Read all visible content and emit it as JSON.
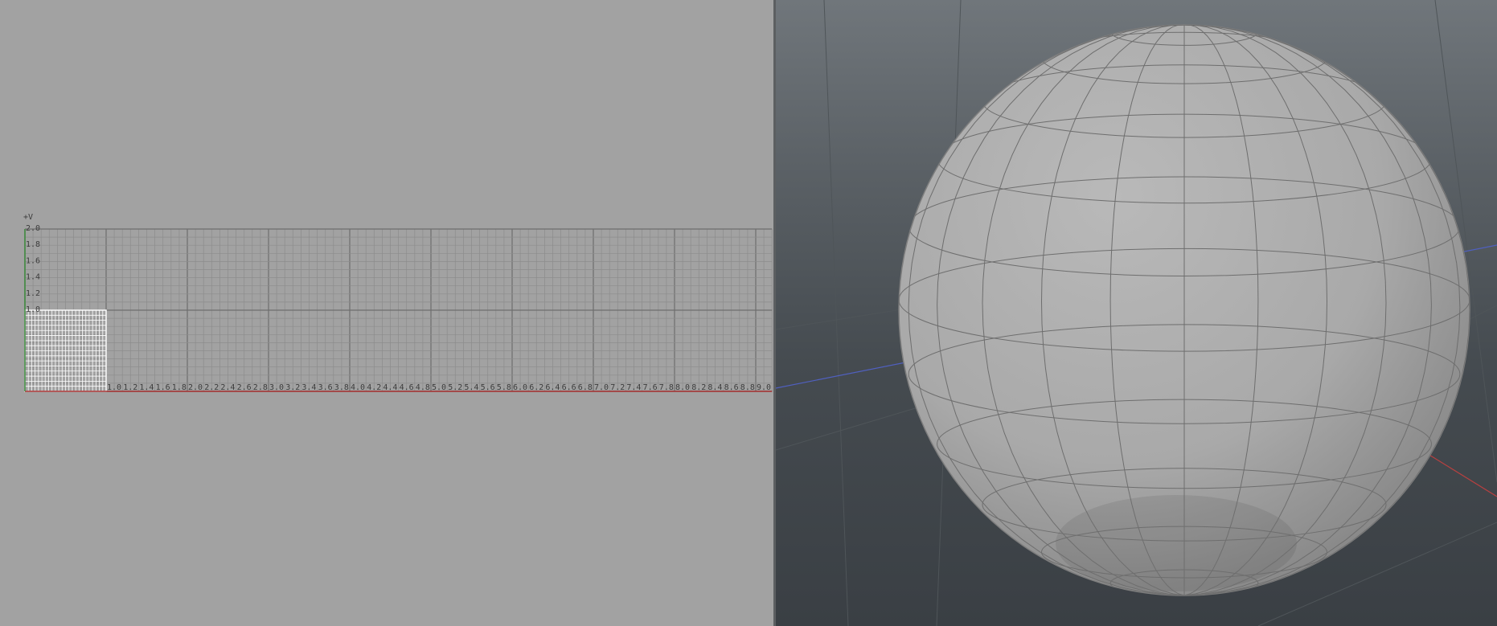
{
  "uv_editor": {
    "v_axis_label": "+V",
    "v_ticks": [
      "2.0",
      "1.8",
      "1.6",
      "1.4",
      "1.2",
      "1.0"
    ],
    "u_ticks": [
      "1.0",
      "1.2",
      "1.4",
      "1.6",
      "1.8",
      "2.0",
      "2.2",
      "2.4",
      "2.6",
      "2.8",
      "3.0",
      "3.2",
      "3.4",
      "3.6",
      "3.8",
      "4.0",
      "4.2",
      "4.4",
      "4.6",
      "4.8",
      "5.0",
      "5.2",
      "5.4",
      "5.6",
      "5.8",
      "6.0",
      "6.2",
      "6.4",
      "6.6",
      "6.8",
      "7.0",
      "7.2",
      "7.4",
      "7.6",
      "7.8",
      "8.0",
      "8.2",
      "8.4",
      "8.6",
      "8.8",
      "9.0"
    ],
    "u_range": [
      0,
      9.2
    ],
    "v_range": [
      0,
      2.0
    ],
    "colors": {
      "background": "#a2a2a2",
      "grid_minor": "#8c8c8c",
      "grid_major": "#6e6e6e",
      "uv_island": "#ffffff",
      "u_axis": "#a83232",
      "v_axis": "#3a8a3a"
    }
  },
  "viewport_3d": {
    "object": "sphere",
    "colors": {
      "bg_top": "#70767b",
      "bg_bottom": "#3a3f44",
      "mesh_fill": "#a9a9a9",
      "wireframe": "#6e6e6e",
      "x_axis": "#b84040",
      "z_axis": "#5060c0"
    }
  }
}
